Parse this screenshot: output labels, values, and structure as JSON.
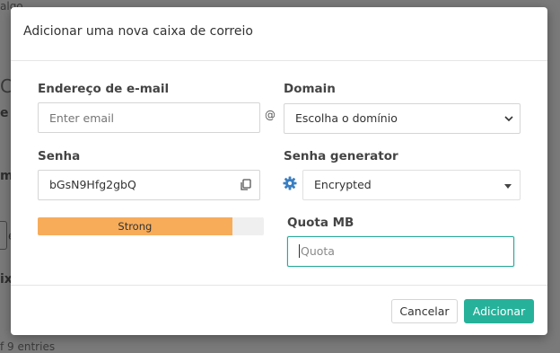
{
  "background": {
    "top_fragment": "algo",
    "big_fragment": "C",
    "e_fragment": "e",
    "m_fragment": "m",
    "box_fragment": "e",
    "ix_fragment": "ix",
    "entries_fragment": "f 9 entries"
  },
  "modal": {
    "title": "Adicionar uma nova caixa de correio",
    "email": {
      "label": "Endereço de e-mail",
      "placeholder": "Enter email",
      "value": ""
    },
    "at": "@",
    "domain": {
      "label": "Domain",
      "selected": "Escolha o domínio"
    },
    "password": {
      "label": "Senha",
      "value": "bGsN9Hfg2gbQ",
      "copy_icon": "copy-icon"
    },
    "password_generator": {
      "label": "Senha generator",
      "selected": "Encrypted",
      "icon": "gear-icon"
    },
    "strength": {
      "text": "Strong",
      "level": 0.86,
      "color": "#f7ac5a"
    },
    "quota": {
      "label": "Quota MB",
      "placeholder": "Quota",
      "value": ""
    },
    "buttons": {
      "cancel": "Cancelar",
      "add": "Adicionar"
    },
    "colors": {
      "accent": "#26b19a",
      "focus_border": "#2aa89a",
      "gear": "#3a7fc1"
    }
  }
}
